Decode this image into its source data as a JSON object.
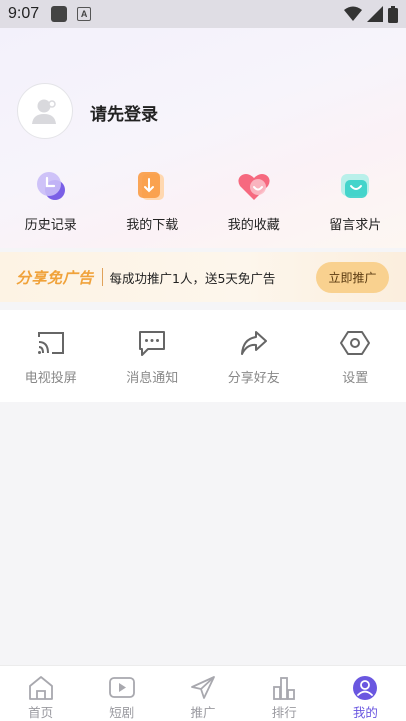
{
  "status_bar": {
    "time": "9:07",
    "a_badge": "A"
  },
  "profile": {
    "login_prompt": "请先登录"
  },
  "quick_actions": [
    {
      "label": "历史记录",
      "icon": "history-icon"
    },
    {
      "label": "我的下载",
      "icon": "download-icon"
    },
    {
      "label": "我的收藏",
      "icon": "favorite-icon"
    },
    {
      "label": "留言求片",
      "icon": "request-icon"
    }
  ],
  "promo": {
    "title": "分享免广告",
    "description": "每成功推广1人，送5天免广告",
    "button": "立即推广"
  },
  "tools": [
    {
      "label": "电视投屏",
      "icon": "cast-icon"
    },
    {
      "label": "消息通知",
      "icon": "message-icon"
    },
    {
      "label": "分享好友",
      "icon": "share-icon"
    },
    {
      "label": "设置",
      "icon": "settings-icon"
    }
  ],
  "bottom_nav": [
    {
      "label": "首页",
      "icon": "home-icon"
    },
    {
      "label": "短剧",
      "icon": "play-icon"
    },
    {
      "label": "推广",
      "icon": "send-icon"
    },
    {
      "label": "排行",
      "icon": "chart-icon"
    },
    {
      "label": "我的",
      "icon": "profile-icon",
      "active": true
    }
  ],
  "colors": {
    "accent": "#6a57e0",
    "promo": "#f0a23a",
    "promo_button": "#f9d18f"
  }
}
